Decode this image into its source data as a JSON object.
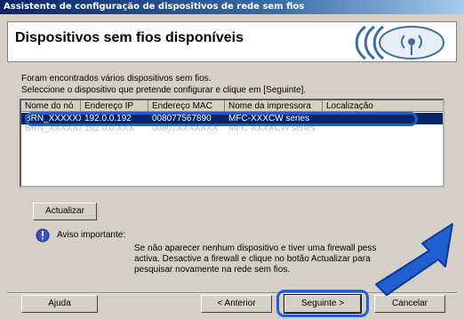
{
  "window": {
    "title": "Assistente de configuração de dispositivos de rede sem fios"
  },
  "banner": {
    "title": "Dispositivos sem fios disponíveis"
  },
  "instructions": [
    "Foram encontrados vários dispositivos sem fios.",
    "Seleccione o dispositivo que pretende configurar e clique em [Seguinte]."
  ],
  "table": {
    "columns": [
      "Nome do nó",
      "Endereço IP",
      "Endereço MAC",
      "Nome da impressora",
      "Localização"
    ],
    "rows": [
      [
        "BRN_XXXXXX",
        "192.0.0.192",
        "008077567890",
        "MFC-XXXCW series",
        ""
      ],
      [
        "BRN_XXXXXX",
        "192.0.0.XXX",
        "00807XXXXXXX",
        "MFC-XXXXCW series",
        ""
      ]
    ]
  },
  "buttons": {
    "refresh": "Actualizar",
    "help": "Ajuda",
    "back": "< Anterior",
    "next": "Seguinte >",
    "cancel": "Cancelar"
  },
  "notice": {
    "title": "Aviso importante:",
    "lines": [
      "Se não aparecer nenhum dispositivo e tiver uma firewall pess",
      "activa. Desactive a firewall e clique no botão Actualizar para",
      "pesquisar novamente na rede sem fios."
    ]
  },
  "colors": {
    "selection": "#0a246a",
    "callout": "#1f5fcf"
  },
  "icons": {
    "banner": "wireless-icon",
    "notice": "warning-icon",
    "callout": "arrow-icon"
  }
}
